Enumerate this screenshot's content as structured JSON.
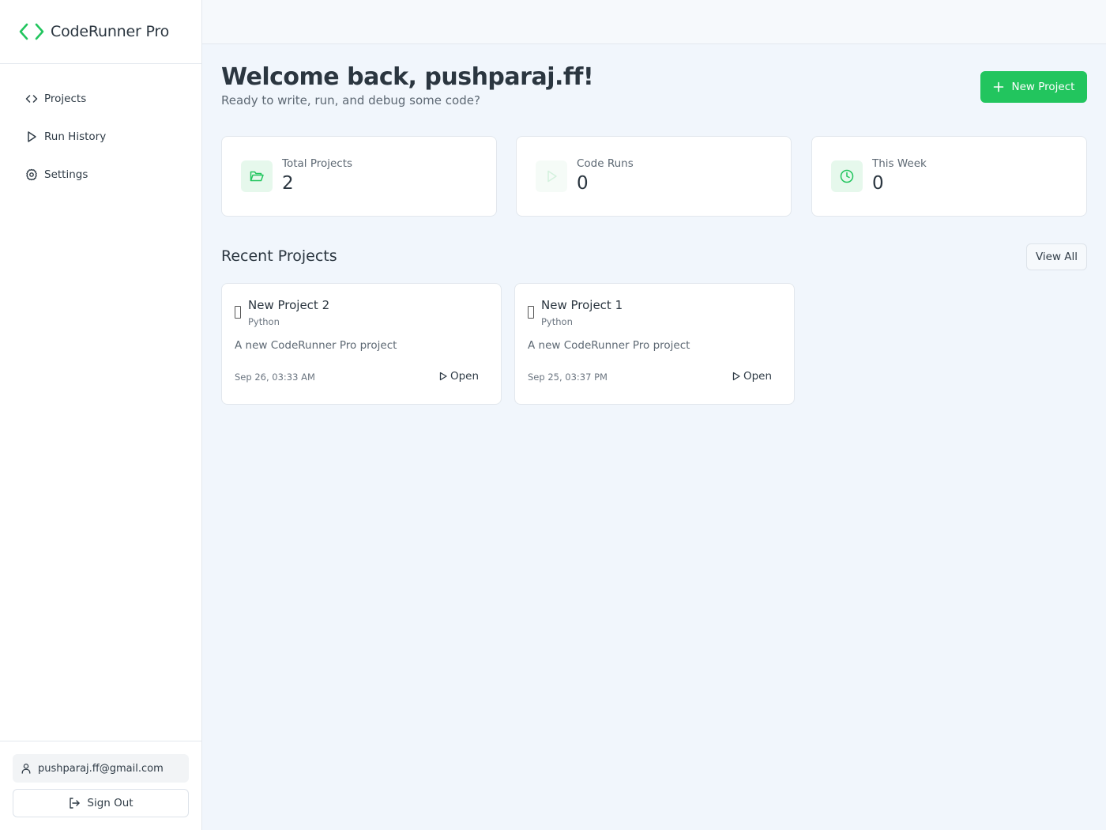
{
  "app": {
    "name": "CodeRunner Pro"
  },
  "colors": {
    "accent": "#22c55e",
    "accent_soft": "#e6f8ec"
  },
  "sidebar": {
    "items": [
      {
        "label": "Projects",
        "icon": "code-icon"
      },
      {
        "label": "Run History",
        "icon": "play-icon"
      },
      {
        "label": "Settings",
        "icon": "gear-icon"
      }
    ],
    "user_email": "pushparaj.ff@gmail.com",
    "signout_label": "Sign Out"
  },
  "header": {
    "title": "Welcome back, pushparaj.ff!",
    "subtitle": "Ready to write, run, and debug some code?",
    "new_project_label": "New Project"
  },
  "stats": [
    {
      "label": "Total Projects",
      "value": "2",
      "icon": "folder-open-icon"
    },
    {
      "label": "Code Runs",
      "value": "0",
      "icon": "play-icon"
    },
    {
      "label": "This Week",
      "value": "0",
      "icon": "clock-icon"
    }
  ],
  "recent": {
    "title": "Recent Projects",
    "view_all_label": "View All",
    "projects": [
      {
        "name": "New Project 2",
        "language": "Python",
        "description": "A new CodeRunner Pro project",
        "date": "Sep 26, 03:33 AM",
        "open_label": "Open"
      },
      {
        "name": "New Project 1",
        "language": "Python",
        "description": "A new CodeRunner Pro project",
        "date": "Sep 25, 03:37 PM",
        "open_label": "Open"
      }
    ]
  }
}
